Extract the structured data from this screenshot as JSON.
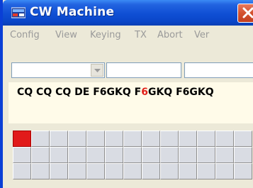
{
  "window": {
    "title": "CW Machine",
    "icon": "app-window-icon",
    "close_icon": "close-icon"
  },
  "menu": {
    "items": [
      "Config",
      "View",
      "Keying",
      "TX",
      "Abort",
      "Ver"
    ]
  },
  "toolbar": {
    "combo_value": "",
    "combo_icon": "chevron-down-icon",
    "field1_value": "",
    "field2_value": ""
  },
  "message": {
    "sent_text": "CQ CQ CQ DE F6GKQ F",
    "current_char": "6",
    "pending_text": "GKQ F6GKQ"
  },
  "grid": {
    "rows": 3,
    "cols": 13,
    "active_cells": [
      [
        0,
        0
      ]
    ]
  },
  "colors": {
    "title_bar": "#0a46c8",
    "close_button": "#d3512e",
    "active_cell": "#e11a1a",
    "current_char": "#e0201a",
    "text_area_bg": "#fffbe9"
  }
}
